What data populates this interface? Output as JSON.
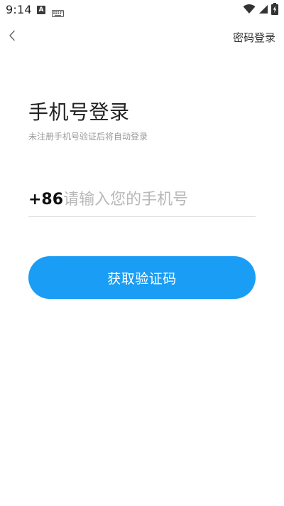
{
  "status_bar": {
    "time": "9:14",
    "icons": [
      "a-notification-icon",
      "keyboard-icon",
      "wifi-icon",
      "signal-icon",
      "battery-charging-icon"
    ]
  },
  "nav": {
    "back_icon": "chevron-left-icon",
    "password_login_label": "密码登录"
  },
  "header": {
    "title": "手机号登录",
    "subtitle": "未注册手机号验证后将自动登录"
  },
  "phone_form": {
    "country_code": "+86",
    "phone_value": "",
    "phone_placeholder": "请输入您的手机号"
  },
  "actions": {
    "get_code_label": "获取验证码"
  },
  "colors": {
    "primary": "#1a9df5",
    "placeholder": "#b8b8b8",
    "subtitle": "#9a9a9a",
    "divider": "#dcdcdc"
  }
}
